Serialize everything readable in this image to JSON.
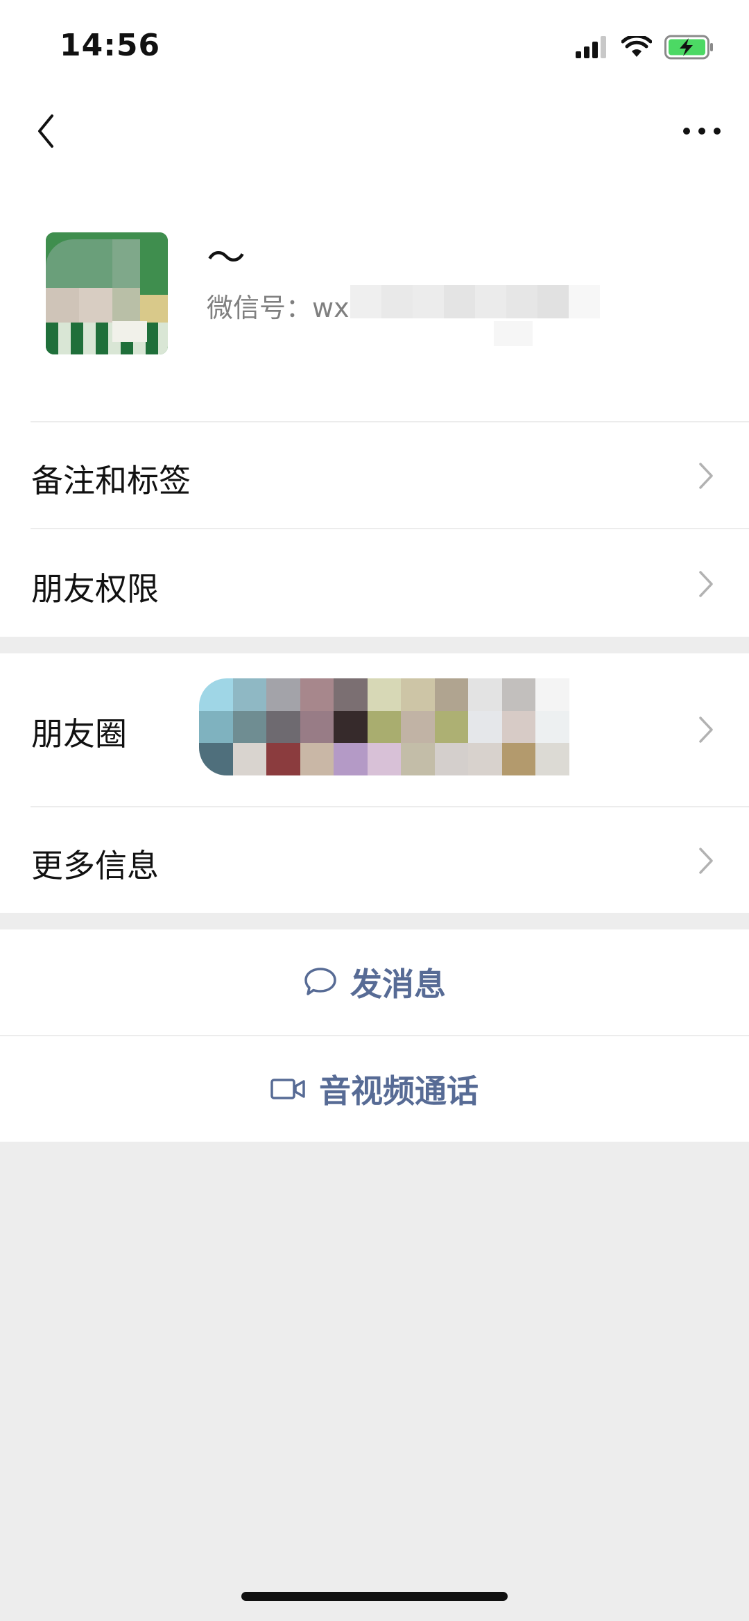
{
  "status_bar": {
    "time": "14:56"
  },
  "nav": {
    "back_icon": "chevron-left-icon",
    "more_icon": "ellipsis-icon"
  },
  "profile": {
    "nickname": "～",
    "wechat_id_label": "微信号：wx"
  },
  "menu": {
    "remarks_tags": "备注和标签",
    "friend_permissions": "朋友权限",
    "moments": "朋友圈",
    "more_info": "更多信息"
  },
  "actions": {
    "send_message": "发消息",
    "voice_video_call": "音视频通话"
  },
  "colors": {
    "link_blue": "#576b95",
    "background_gray": "#ededed",
    "battery_green": "#4cd964"
  }
}
